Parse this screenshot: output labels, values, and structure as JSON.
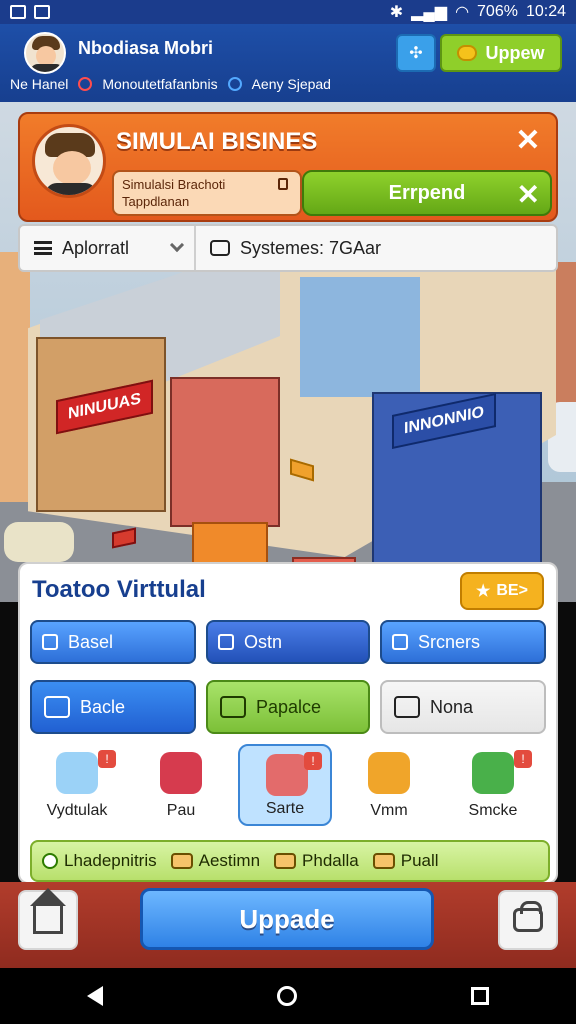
{
  "status_bar": {
    "battery": "706%",
    "time": "10:24"
  },
  "header": {
    "player_name": "Nbodiasa Mobri",
    "sub_1": "Ne Hanel",
    "sub_2": "Monoutetfafanbnis",
    "sub_3": "Aeny Sjepad",
    "upgrade_label": "Uppew"
  },
  "title_panel": {
    "title": "SIMULAI BISINES",
    "subtitle_line1": "Simulalsi Brachoti",
    "subtitle_line2": "Tappdlanan",
    "expand_label": "Errpend"
  },
  "filter": {
    "selected": "Aplorratl",
    "info": "Systemes: 7GAar"
  },
  "scene": {
    "banner_1": "NINUUAS",
    "banner_2": "INNONNIO",
    "banner_3": "",
    "banner_4": ""
  },
  "bottom_panel": {
    "title": "Toatoo Virttulal",
    "star_btn": "BE>",
    "tabs": [
      "Basel",
      "Ostn",
      "Srcners"
    ],
    "row2": [
      "Bacle",
      "Papalce",
      "Nona"
    ],
    "items": [
      {
        "label": "Vydtulak"
      },
      {
        "label": "Pau"
      },
      {
        "label": "Sarte"
      },
      {
        "label": "Vmm"
      },
      {
        "label": "Smcke"
      }
    ],
    "promo": [
      "Lhadepnitris",
      "Aestimn",
      "Phdalla",
      "Puall"
    ]
  },
  "bottom_bar": {
    "upgrade_label": "Uppade"
  },
  "colors": {
    "primary": "#1e4fa8",
    "accent": "#f17c2a",
    "action": "#2f82e6",
    "bottom": "#b23d2c"
  }
}
